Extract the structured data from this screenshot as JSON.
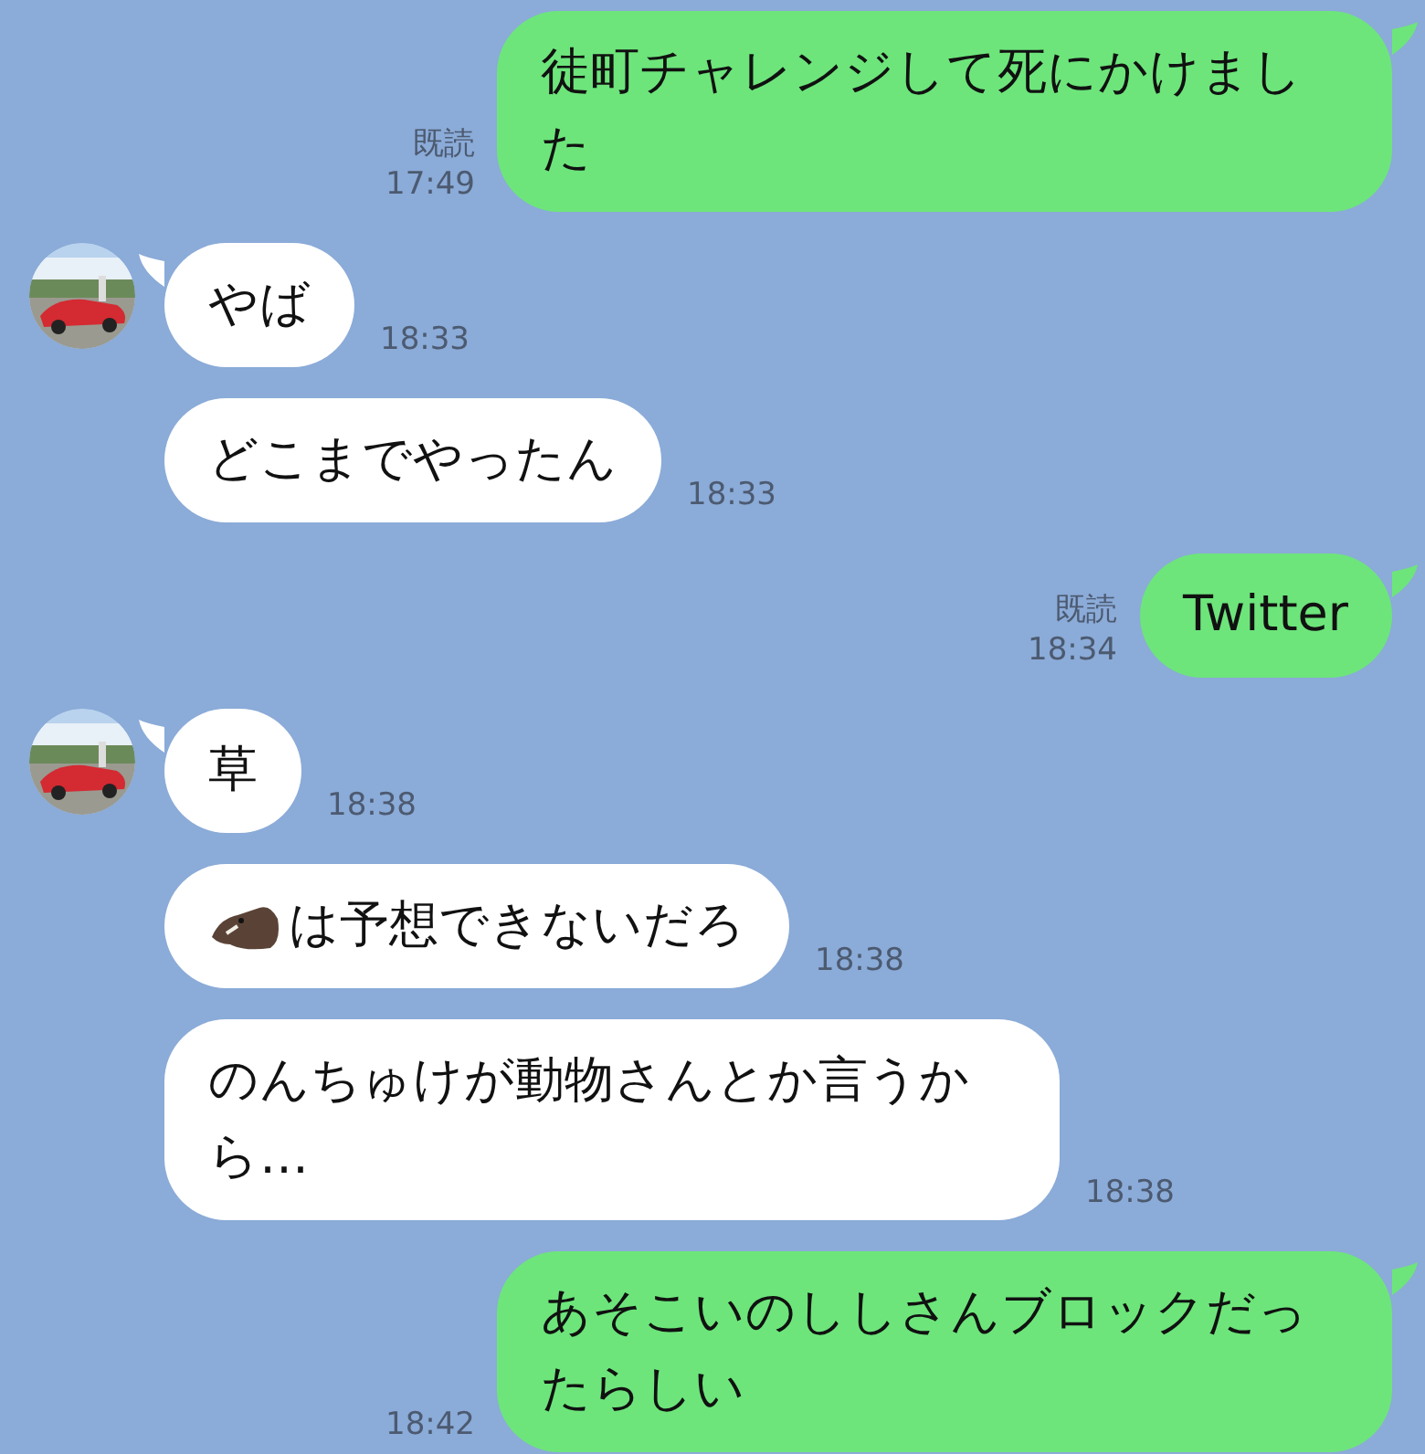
{
  "messages": [
    {
      "kind": "sent",
      "text": "徒町チャレンジして死にかけました",
      "read": "既読",
      "time": "17:49",
      "tail": true
    },
    {
      "kind": "received",
      "text": "やば",
      "time": "18:33",
      "tail": true,
      "avatar": true
    },
    {
      "kind": "received",
      "text": "どこまでやったん",
      "time": "18:33",
      "tail": false,
      "avatar": false
    },
    {
      "kind": "sent",
      "text": "Twitter",
      "read": "既読",
      "time": "18:34",
      "tail": true
    },
    {
      "kind": "received",
      "text": "草",
      "time": "18:38",
      "tail": true,
      "avatar": true
    },
    {
      "kind": "received",
      "text": "は予想できないだろ",
      "time": "18:38",
      "tail": false,
      "avatar": false,
      "boar_icon": true
    },
    {
      "kind": "received",
      "text": "のんちゅけが動物さんとか言うから…",
      "time": "18:38",
      "tail": false,
      "avatar": false
    },
    {
      "kind": "sent",
      "text": "あそこいのししさんブロックだったらしい",
      "time": "18:42",
      "tail": true
    }
  ]
}
